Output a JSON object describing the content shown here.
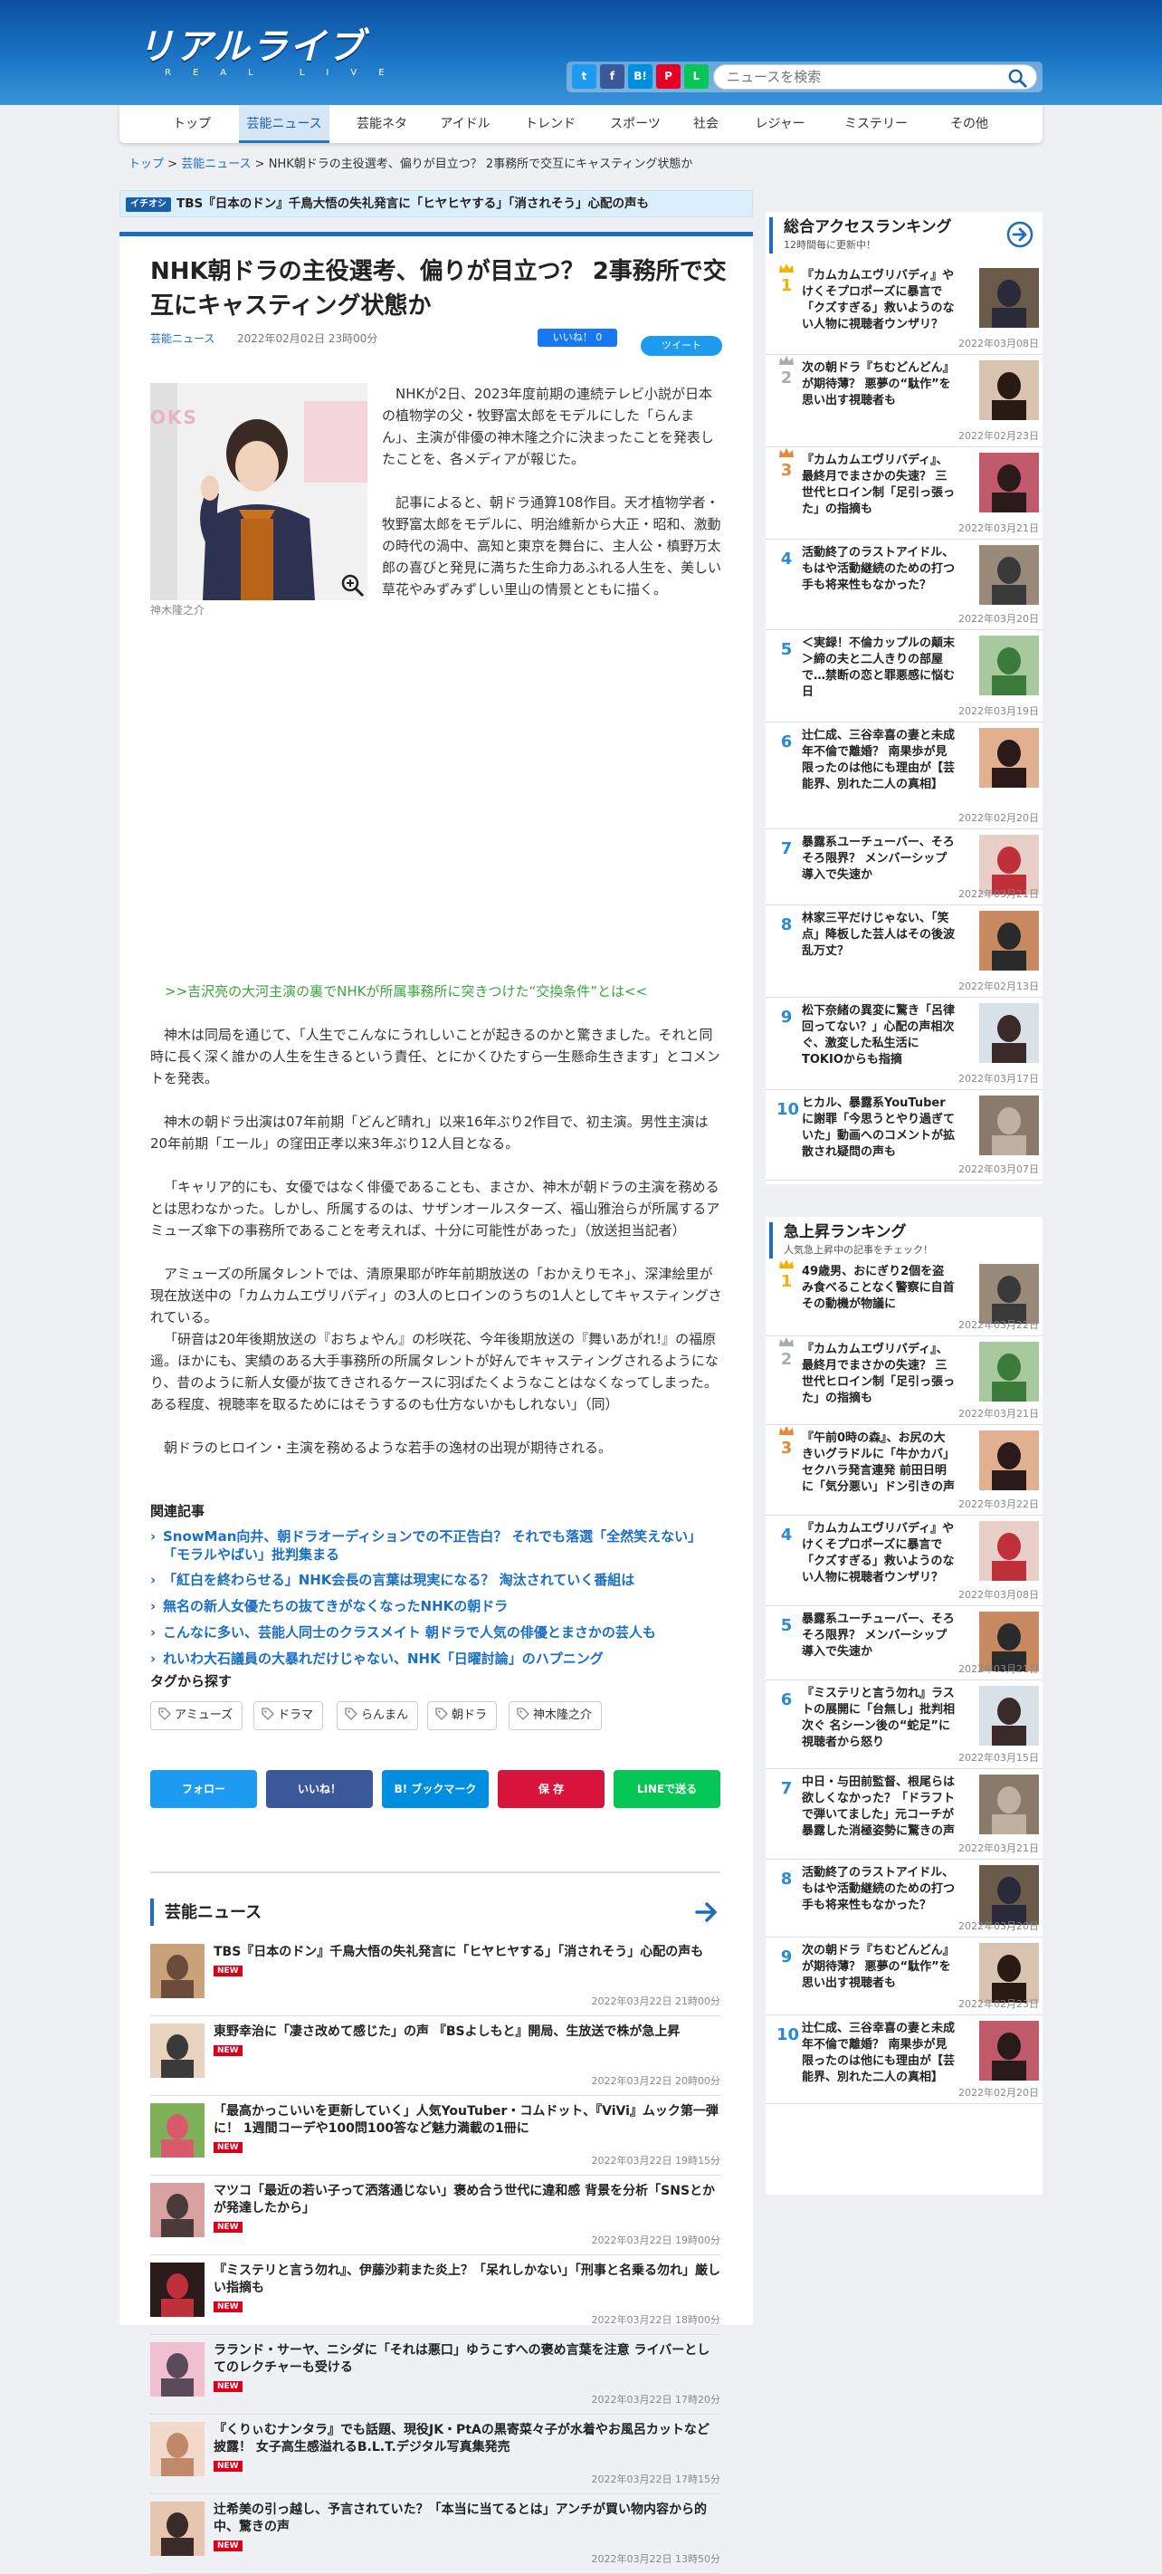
{
  "header": {
    "logo_main": "リアルライブ",
    "logo_sub": "REAL LIVE",
    "search_placeholder": "ニュースを検索",
    "share_icons": [
      {
        "name": "twitter",
        "glyph": "t",
        "color": "#1d9bf0"
      },
      {
        "name": "facebook",
        "glyph": "f",
        "color": "#3b5998"
      },
      {
        "name": "hatena",
        "glyph": "B!",
        "color": "#008fde"
      },
      {
        "name": "pinterest",
        "glyph": "P",
        "color": "#e60023"
      },
      {
        "name": "line",
        "glyph": "L",
        "color": "#06c755"
      }
    ]
  },
  "nav": {
    "items": [
      "トップ",
      "芸能ニュース",
      "芸能ネタ",
      "アイドル",
      "トレンド",
      "スポーツ",
      "社会",
      "レジャー",
      "ミステリー",
      "その他"
    ]
  },
  "breadcrumb": {
    "top": "トップ",
    "sep": " > ",
    "category": "芸能ニュース",
    "current": "NHK朝ドラの主役選考、偏りが目立つ？ 2事務所で交互にキャスティング状態か"
  },
  "ticker": {
    "badge": "イチオシ",
    "text": "TBS『日本のドン』千鳥大悟の失礼発言に「ヒヤヒヤする」「消されそう」心配の声も"
  },
  "article": {
    "title": "NHK朝ドラの主役選考、偏りが目立つ？ 2事務所で交互にキャスティング状態か",
    "category": "芸能ニュース",
    "date": "2022年02月02日 23時00分",
    "like_label": "いいね！ 0",
    "tweet_label": "ツイート",
    "photo_caption": "神木隆之介",
    "photo_sign": "OKS",
    "p1": "NHKが2日、2023年度前期の連続テレビ小説が日本の植物学の父・牧野富太郎をモデルにした「らんまん」、主演が俳優の神木隆之介に決まったことを発表したことを、各メディアが報じた。",
    "p2": "記事によると、朝ドラ通算108作目。天才植物学者・牧野富太郎をモデルに、明治維新から大正・昭和、激動の時代の渦中、高知と東京を舞台に、主人公・槙野万太郎の喜びと発見に満ちた生命力あふれる人生を、美しい草花やみずみずしい里山の情景とともに描く。",
    "related_inline": ">>吉沢亮の大河主演の裏でNHKが所属事務所に突きつけた“交換条件”とは<<",
    "p3": "神木は同局を通じて、「人生でこんなにうれしいことが起きるのかと驚きました。それと同時に長く深く誰かの人生を生きるという責任、とにかくひたすら一生懸命生きます」とコメントを発表。",
    "p4": "神木の朝ドラ出演は07年前期「どんど晴れ」以来16年ぶり2作目で、初主演。男性主演は20年前期「エール」の窪田正孝以来3年ぶり12人目となる。",
    "p5": "「キャリア的にも、女優ではなく俳優であることも、まさか、神木が朝ドラの主演を務めるとは思わなかった。しかし、所属するのは、サザンオールスターズ、福山雅治らが所属するアミューズ傘下の事務所であることを考えれば、十分に可能性があった」（放送担当記者）",
    "p6": "アミューズの所属タレントでは、清原果耶が昨年前期放送の「おかえりモネ」、深津絵里が現在放送中の「カムカムエヴリバディ」の3人のヒロインのうちの1人としてキャスティングされている。",
    "p7": "「研音は20年後期放送の『おちょやん』の杉咲花、今年後期放送の『舞いあがれ!』の福原遥。ほかにも、実績のある大手事務所の所属タレントが好んでキャスティングされるようになり、昔のように新人女優が抜てきされるケースに羽ばたくようなことはなくなってしまった。ある程度、視聴率を取るためにはそうするのも仕方ないかもしれない」（同）",
    "p8": "朝ドラのヒロイン・主演を務めるような若手の逸材の出現が期待される。"
  },
  "related": {
    "heading": "関連記事",
    "items": [
      "SnowMan向井、朝ドラオーディションでの不正告白？ それでも落選「全然笑えない」「モラルやばい」批判集まる",
      "「紅白を終わらせる」NHK会長の言葉は現実になる？ 淘汰されていく番組は",
      "無名の新人女優たちの抜てきがなくなったNHKの朝ドラ",
      "こんなに多い、芸能人同士のクラスメイト 朝ドラで人気の俳優とまさかの芸人も",
      "れいわ大石議員の大暴れだけじゃない、NHK「日曜討論」のハプニング"
    ]
  },
  "tags": {
    "heading": "タグから探す",
    "items": [
      "アミューズ",
      "ドラマ",
      "らんまん",
      "朝ドラ",
      "神木隆之介"
    ]
  },
  "share_buttons": [
    {
      "label": "フォロー",
      "color": "#1d9bf0"
    },
    {
      "label": "いいね！",
      "color": "#3b5998"
    },
    {
      "label": "B! ブックマーク",
      "color": "#008fde"
    },
    {
      "label": "保 存",
      "color": "#d7143a"
    },
    {
      "label": "LINEで送る",
      "color": "#06c755"
    }
  ],
  "latest_news": {
    "heading": "芸能ニュース",
    "new_label": "NEW",
    "items": [
      {
        "title": "TBS『日本のドン』千鳥大悟の失礼発言に「ヒヤヒヤする」「消されそう」心配の声も",
        "date": "2022年03月22日 21時00分"
      },
      {
        "title": "東野幸治に「凄さ改めて感じた」の声 『BSよしもと』開局、生放送で株が急上昇",
        "date": "2022年03月22日 20時00分"
      },
      {
        "title": "「最高かっこいいを更新していく」人気YouTuber・コムドット、『ViVi』ムック第一弾に！ 1週間コーデや100問100答など魅力満載の1冊に",
        "date": "2022年03月22日 19時15分"
      },
      {
        "title": "マツコ「最近の若い子って洒落通じない」褒め合う世代に違和感 背景を分析「SNSとかが発達したから」",
        "date": "2022年03月22日 19時00分"
      },
      {
        "title": "『ミステリと言う勿れ』、伊藤沙莉また炎上？「呆れしかない」「刑事と名乗る勿れ」厳しい指摘も",
        "date": "2022年03月22日 18時00分"
      },
      {
        "title": "ラランド・サーヤ、ニシダに「それは悪口」ゆうこすへの褒め言葉を注意 ライバーとしてのレクチャーも受ける",
        "date": "2022年03月22日 17時20分"
      },
      {
        "title": "『くりぃむナンタラ』でも話題、現役JK・PtAの黒寄菜々子が水着やお風呂カットなど披露！ 女子高生感溢れるB.L.T.デジタル写真集発売",
        "date": "2022年03月22日 17時15分"
      },
      {
        "title": "辻希美の引っ越し、予言されていた？「本当に当てるとは」アンチが買い物内容から的中、驚きの声",
        "date": "2022年03月22日 13時50分"
      }
    ]
  },
  "ranking_total": {
    "title": "総合アクセスランキング",
    "subtitle": "12時間毎に更新中！",
    "items": [
      {
        "rank": "1",
        "title": "『カムカムエヴリバディ』やけくそプロポーズに暴言で「クズすぎる」救いようのない人物に視聴者ウンザリ？",
        "date": "2022年03月08日"
      },
      {
        "rank": "2",
        "title": "次の朝ドラ『ちむどんどん』が期待薄？ 悪夢の“駄作”を思い出す視聴者も",
        "date": "2022年02月23日"
      },
      {
        "rank": "3",
        "title": "『カムカムエヴリバディ』、最終月でまさかの失速？ 三世代ヒロイン制「足引っ張った」の指摘も",
        "date": "2022年03月21日"
      },
      {
        "rank": "4",
        "title": "活動終了のラストアイドル、もはや活動継続のための打つ手も将来性もなかった？",
        "date": "2022年03月20日"
      },
      {
        "rank": "5",
        "title": "＜実録！不倫カップルの顛末＞締の夫と二人きりの部屋で…禁断の恋と罪悪感に悩む日",
        "date": "2022年03月19日"
      },
      {
        "rank": "6",
        "title": "辻仁成、三谷幸喜の妻と未成年不倫で離婚？ 南果歩が見限ったのは他にも理由が【芸能界、別れた二人の真相】",
        "date": "2022年02月20日"
      },
      {
        "rank": "7",
        "title": "暴露系ユーチューバー、そろそろ限界？ メンバーシップ導入で失速か",
        "date": "2022年03月21日"
      },
      {
        "rank": "8",
        "title": "林家三平だけじゃない、「笑点」降板した芸人はその後波乱万丈？",
        "date": "2022年02月13日"
      },
      {
        "rank": "9",
        "title": "松下奈緒の異変に驚き「呂律回ってない？」心配の声相次ぐ、激変した私生活にTOKIOからも指摘",
        "date": "2022年03月17日"
      },
      {
        "rank": "10",
        "title": "ヒカル、暴露系YouTuberに謝罪「今思うとやり過ぎていた」動画へのコメントが拡散され疑問の声も",
        "date": "2022年03月07日"
      }
    ]
  },
  "ranking_rising": {
    "title": "急上昇ランキング",
    "subtitle": "人気急上昇中の記事をチェック！",
    "items": [
      {
        "rank": "1",
        "title": "49歳男、おにぎり2個を盗み食べることなく警察に自首 その動機が物議に",
        "date": "2022年03月22日"
      },
      {
        "rank": "2",
        "title": "『カムカムエヴリバディ』、最終月でまさかの失速？ 三世代ヒロイン制「足引っ張った」の指摘も",
        "date": "2022年03月21日"
      },
      {
        "rank": "3",
        "title": "『午前0時の森』、お尻の大きいグラドルに「牛かカバ」セクハラ発言連発 前田日明に「気分悪い」ドン引きの声",
        "date": "2022年03月22日"
      },
      {
        "rank": "4",
        "title": "『カムカムエヴリバディ』やけくそプロポーズに暴言で「クズすぎる」救いようのない人物に視聴者ウンザリ？",
        "date": "2022年03月08日"
      },
      {
        "rank": "5",
        "title": "暴露系ユーチューバー、そろそろ限界？ メンバーシップ導入で失速か",
        "date": "2022年03月21日"
      },
      {
        "rank": "6",
        "title": "『ミステリと言う勿れ』ラストの展開に「台無し」批判相次ぐ 名シーン後の“蛇足”に視聴者から怒り",
        "date": "2022年03月15日"
      },
      {
        "rank": "7",
        "title": "中日・与田前監督、根尾らは欲しくなかった？「ドラフトで弾いてました」元コーチが暴露した消極姿勢に驚きの声",
        "date": "2022年03月21日"
      },
      {
        "rank": "8",
        "title": "活動終了のラストアイドル、もはや活動継続のための打つ手も将来性もなかった？",
        "date": "2022年03月20日"
      },
      {
        "rank": "9",
        "title": "次の朝ドラ『ちむどんどん』が期待薄？ 悪夢の“駄作”を思い出す視聴者も",
        "date": "2022年02月23日"
      },
      {
        "rank": "10",
        "title": "辻仁成、三谷幸喜の妻と未成年不倫で離婚？ 南果歩が見限ったのは他にも理由が【芸能界、別れた二人の真相】",
        "date": "2022年02月20日"
      }
    ]
  },
  "colors": {
    "brand_blue": "#1e6cc0",
    "gold": "#f0b400",
    "silver": "#a8adb5",
    "bronze": "#e08a3a",
    "new_red": "#d9001b"
  }
}
